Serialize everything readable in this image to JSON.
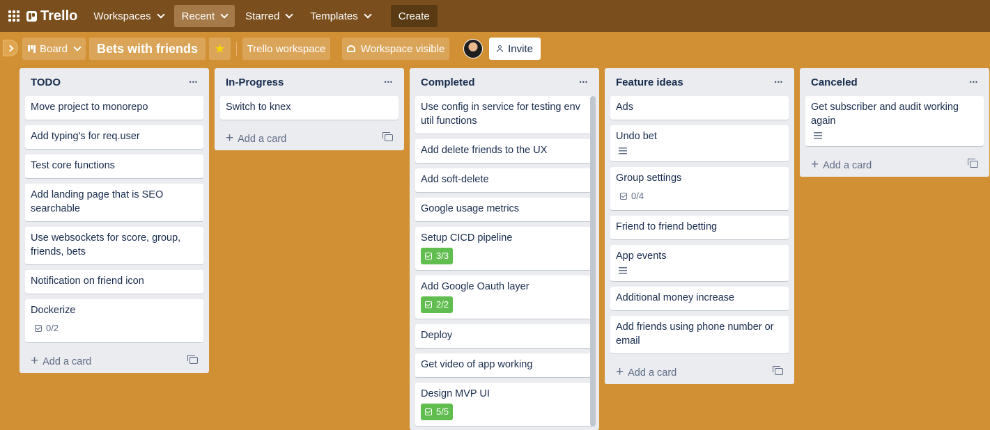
{
  "header": {
    "logo_text": "Trello",
    "nav": [
      {
        "label": "Workspaces"
      },
      {
        "label": "Recent"
      },
      {
        "label": "Starred"
      },
      {
        "label": "Templates"
      }
    ],
    "create_label": "Create"
  },
  "board": {
    "view_label": "Board",
    "title": "Bets with friends",
    "starred": true,
    "workspace_label": "Trello workspace",
    "visibility_label": "Workspace visible",
    "invite_label": "Invite"
  },
  "lists": [
    {
      "title": "TODO",
      "add_label": "Add a card",
      "cards": [
        {
          "title": "Move project to monorepo"
        },
        {
          "title": "Add typing's for req.user"
        },
        {
          "title": "Test core functions"
        },
        {
          "title": "Add landing page that is SEO searchable"
        },
        {
          "title": "Use websockets for score, group, friends, bets"
        },
        {
          "title": "Notification on friend icon"
        },
        {
          "title": "Dockerize",
          "checklist": "0/2"
        }
      ]
    },
    {
      "title": "In-Progress",
      "add_label": "Add a card",
      "cards": [
        {
          "title": "Switch to knex"
        }
      ]
    },
    {
      "title": "Completed",
      "cards": [
        {
          "title": "Use config in service for testing env util functions"
        },
        {
          "title": "Add delete friends to the UX"
        },
        {
          "title": "Add soft-delete"
        },
        {
          "title": "Google usage metrics"
        },
        {
          "title": "Setup CICD pipeline",
          "checklist": "3/3"
        },
        {
          "title": "Add Google Oauth layer",
          "checklist": "2/2"
        },
        {
          "title": "Deploy"
        },
        {
          "title": "Get video of app working"
        },
        {
          "title": "Design MVP UI",
          "checklist": "5/5"
        }
      ]
    },
    {
      "title": "Feature ideas",
      "add_label": "Add a card",
      "cards": [
        {
          "title": "Ads"
        },
        {
          "title": "Undo bet",
          "has_description": true
        },
        {
          "title": "Group settings",
          "checklist": "0/4"
        },
        {
          "title": "Friend to friend betting"
        },
        {
          "title": "App events",
          "has_description": true
        },
        {
          "title": "Additional money increase"
        },
        {
          "title": "Add friends using phone number or email"
        }
      ]
    },
    {
      "title": "Canceled",
      "add_label": "Add a card",
      "cards": [
        {
          "title": "Get subscriber and audit working again",
          "has_description": true
        }
      ]
    }
  ],
  "colors": {
    "board_bg": "#d29034",
    "header_bg": "#7a4f1d",
    "list_bg": "#ebecf0",
    "checklist_complete": "#61bd4f",
    "star": "#f2d600"
  }
}
